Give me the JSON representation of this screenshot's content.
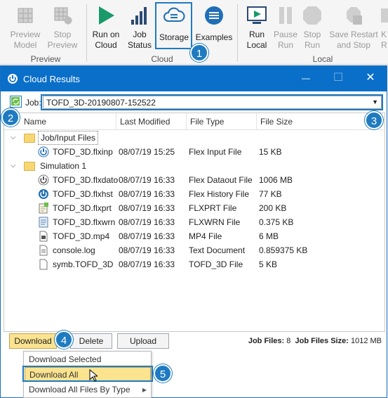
{
  "ribbon": {
    "preview_group": {
      "label": "Preview",
      "preview_model": "Preview\nModel",
      "preview_model_l1": "Preview",
      "preview_model_l2": "Model",
      "stop_preview_l1": "Stop",
      "stop_preview_l2": "Preview"
    },
    "cloud_group": {
      "label": "Cloud",
      "run_on_cloud_l1": "Run on",
      "run_on_cloud_l2": "Cloud",
      "job_status_l1": "Job",
      "job_status_l2": "Status",
      "storage": "Storage",
      "examples": "Examples"
    },
    "local_group": {
      "label": "Local",
      "run_local_l1": "Run",
      "run_local_l2": "Local",
      "pause_run_l1": "Pause",
      "pause_run_l2": "Run",
      "stop_run_l1": "Stop",
      "stop_run_l2": "Run",
      "save_restart_l1": "Save Restart",
      "save_restart_l2": "and Stop",
      "cutoff_l1": "K",
      "cutoff_l2": "R"
    }
  },
  "callouts": [
    "1",
    "2",
    "3",
    "4",
    "5"
  ],
  "window": {
    "title": "Cloud Results",
    "minimize": "—",
    "maximize": "☐",
    "close": "✕",
    "job_label": "Job:",
    "job_value": "TOFD_3D-20190807-152522",
    "columns": [
      "Name",
      "Last Modified",
      "File Type",
      "File Size"
    ],
    "groups": [
      {
        "name": "Job/Input Files",
        "files": [
          {
            "name": "TOFD_3D.flxinp",
            "modified": "08/07/19 15:25",
            "type": "Flex Input File",
            "size": "15 KB",
            "icon": "flex-power-icon"
          }
        ]
      },
      {
        "name": "Simulation 1",
        "files": [
          {
            "name": "TOFD_3D.flxdato",
            "modified": "08/07/19 16:33",
            "type": "Flex Dataout File",
            "size": "1006 MB",
            "icon": "flex-data-icon"
          },
          {
            "name": "TOFD_3D.flxhst",
            "modified": "08/07/19 16:33",
            "type": "Flex History File",
            "size": "77 KB",
            "icon": "flex-power-icon"
          },
          {
            "name": "TOFD_3D.flxprt",
            "modified": "08/07/19 16:33",
            "type": "FLXPRT File",
            "size": "200 KB",
            "icon": "notepad-icon"
          },
          {
            "name": "TOFD_3D.flxwrn",
            "modified": "08/07/19 16:33",
            "type": "FLXWRN File",
            "size": "0.375 KB",
            "icon": "warning-doc-icon"
          },
          {
            "name": "TOFD_3D.mp4",
            "modified": "08/07/19 16:33",
            "type": "MP4 File",
            "size": "6 MB",
            "icon": "video-file-icon"
          },
          {
            "name": "console.log",
            "modified": "08/07/19 16:33",
            "type": "Text Document",
            "size": "0.859375 KB",
            "icon": "text-file-icon"
          },
          {
            "name": "symb.TOFD_3D",
            "modified": "08/07/19 16:33",
            "type": "TOFD_3D File",
            "size": "5 KB",
            "icon": "blank-file-icon"
          }
        ]
      }
    ],
    "buttons": {
      "download": "Download",
      "delete": "Delete",
      "upload": "Upload"
    },
    "status": {
      "job_files_label": "Job Files:",
      "job_files_value": "8",
      "size_label": "Job Files Size:",
      "size_value": "1012 MB"
    }
  },
  "menu": {
    "items": [
      "Download Selected",
      "Download All",
      "Download All Files By Type"
    ],
    "submenu_arrow": "▶"
  },
  "colors": {
    "accent": "#1f7bc1",
    "titlebar": "#0a6fc9",
    "hover": "#fbe38f"
  }
}
